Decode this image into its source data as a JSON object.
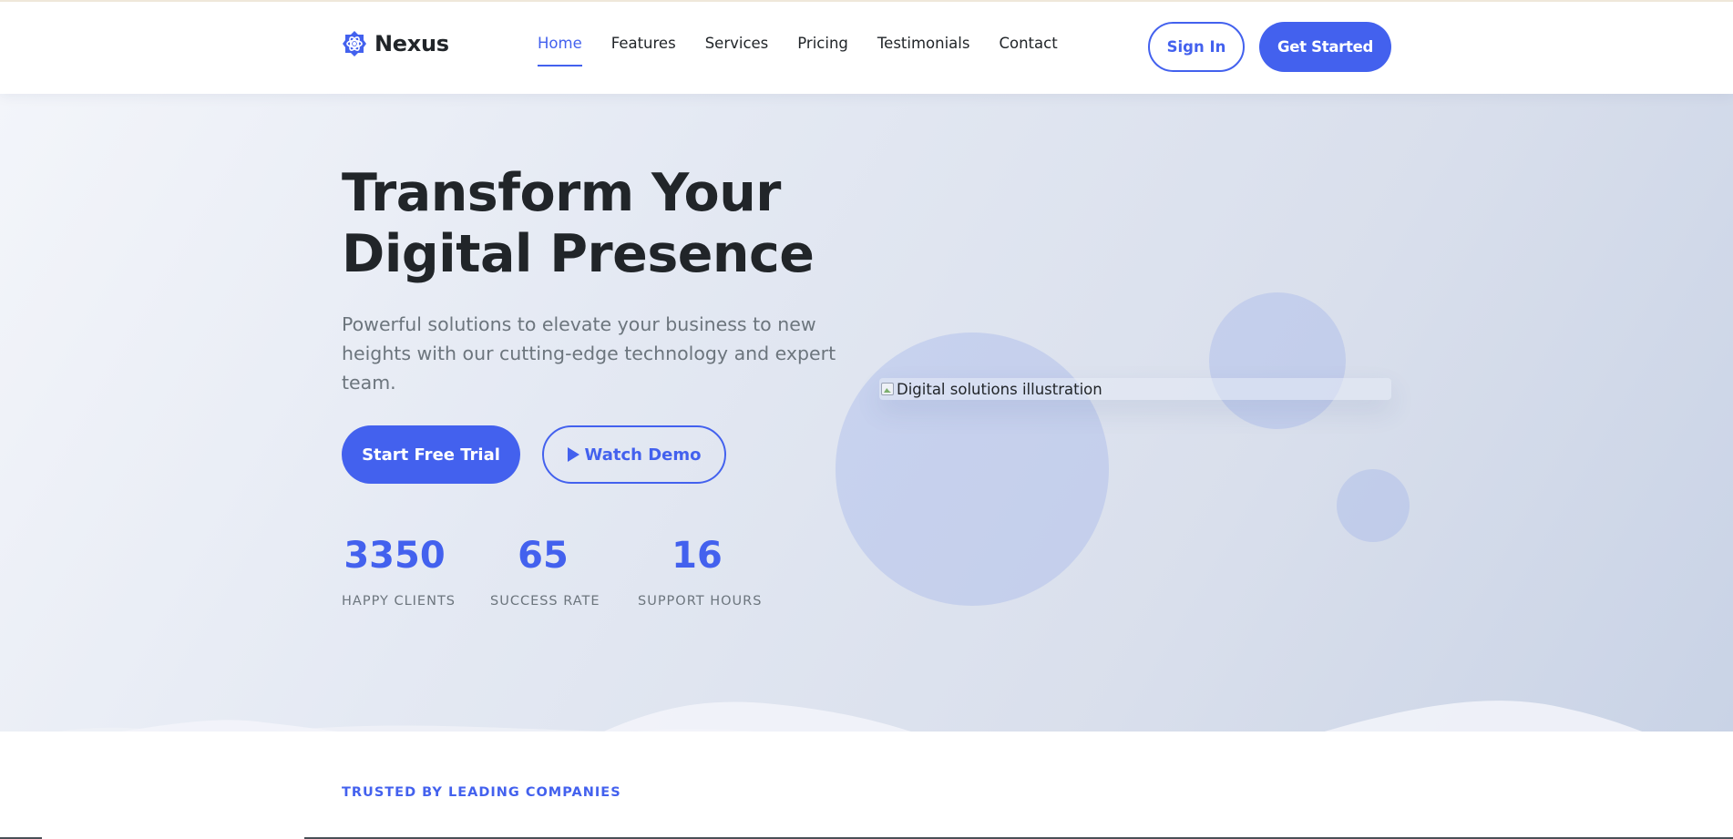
{
  "brand": {
    "name": "Nexus",
    "icon": "gear-atom-icon",
    "accent": "#4361ee"
  },
  "nav": {
    "links": [
      {
        "label": "Home",
        "active": true
      },
      {
        "label": "Features",
        "active": false
      },
      {
        "label": "Services",
        "active": false
      },
      {
        "label": "Pricing",
        "active": false
      },
      {
        "label": "Testimonials",
        "active": false
      },
      {
        "label": "Contact",
        "active": false
      }
    ],
    "signin_label": "Sign In",
    "getstarted_label": "Get Started"
  },
  "hero": {
    "title_line1": "Transform Your",
    "title_line2": "Digital Presence",
    "subtitle": "Powerful solutions to elevate your business to new heights with our cutting-edge technology and expert team.",
    "trial_label": "Start Free Trial",
    "demo_label": "Watch Demo",
    "demo_icon": "play-icon",
    "image_alt": "Digital solutions illustration",
    "stats": [
      {
        "value": "3350",
        "label": "HAPPY CLIENTS"
      },
      {
        "value": "65",
        "label": "SUCCESS RATE"
      },
      {
        "value": "16",
        "label": "SUPPORT HOURS"
      }
    ]
  },
  "trusted": {
    "label": "TRUSTED BY LEADING COMPANIES"
  },
  "colors": {
    "primary": "#4361ee",
    "text": "#212529",
    "muted": "#6c757d"
  }
}
